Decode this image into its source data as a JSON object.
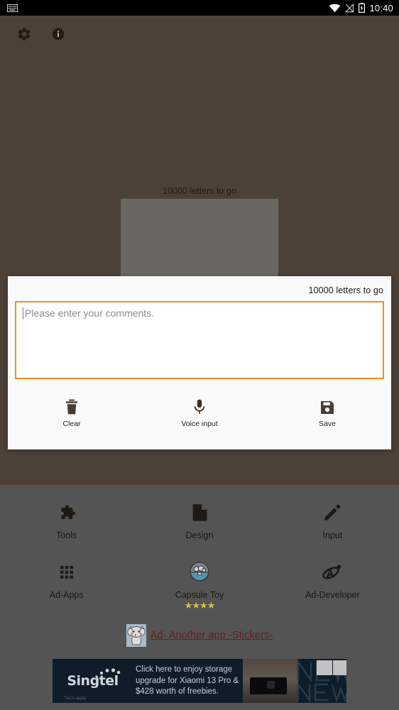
{
  "status_bar": {
    "keyboard_icon": "keyboard-icon",
    "wifi_icon": "wifi-icon",
    "signal_off_icon": "signal-no-service-icon",
    "battery_icon": "battery-charging-icon",
    "clock": "10:40"
  },
  "toolbar": {
    "settings_icon": "gear-icon",
    "info_icon": "info-icon"
  },
  "canvas": {
    "letters_counter": "10000 letters to go"
  },
  "dialog": {
    "letters_counter": "10000 letters to go",
    "input": {
      "placeholder": "Please enter your comments.",
      "value": ""
    },
    "actions": [
      {
        "label": "Clear",
        "icon": "trash-icon"
      },
      {
        "label": "Voice input",
        "icon": "microphone-icon"
      },
      {
        "label": "Save",
        "icon": "floppy-disk-icon"
      }
    ]
  },
  "menu": {
    "row1": [
      {
        "label": "Tools",
        "icon": "puzzle-piece-icon"
      },
      {
        "label": "Design",
        "icon": "document-page-icon"
      },
      {
        "label": "Input",
        "icon": "pencil-icon"
      }
    ],
    "row2": [
      {
        "label": "Ad-Apps",
        "icon": "apps-grid-icon",
        "stars": ""
      },
      {
        "label": "Capsule Toy",
        "icon": "capsule-machine-icon",
        "stars": "★★★★"
      },
      {
        "label": "Ad-Developer",
        "icon": "atom-orbit-icon",
        "stars": ""
      }
    ],
    "sticker_link": {
      "icon": "sticker-elephant-icon",
      "text": "Ad- Another app -Stickers-"
    }
  },
  "banner_ad": {
    "brand": "Singtel",
    "fine_print": "T&Cs apply",
    "copy_lines": [
      "Click here to enjoy storage",
      "upgrade for Xiaomi 13 Pro &",
      "$428 worth of freebies."
    ],
    "art_text": "NEW"
  },
  "colors": {
    "app_background": "#4c4139",
    "menu_panel": "#5e5e5e",
    "dialog_background": "#fafafa",
    "input_focus_border": "#f0901e",
    "link": "#70231d",
    "star": "#e8d44d",
    "banner_background": "#10212e",
    "status_bar": "#000000"
  }
}
